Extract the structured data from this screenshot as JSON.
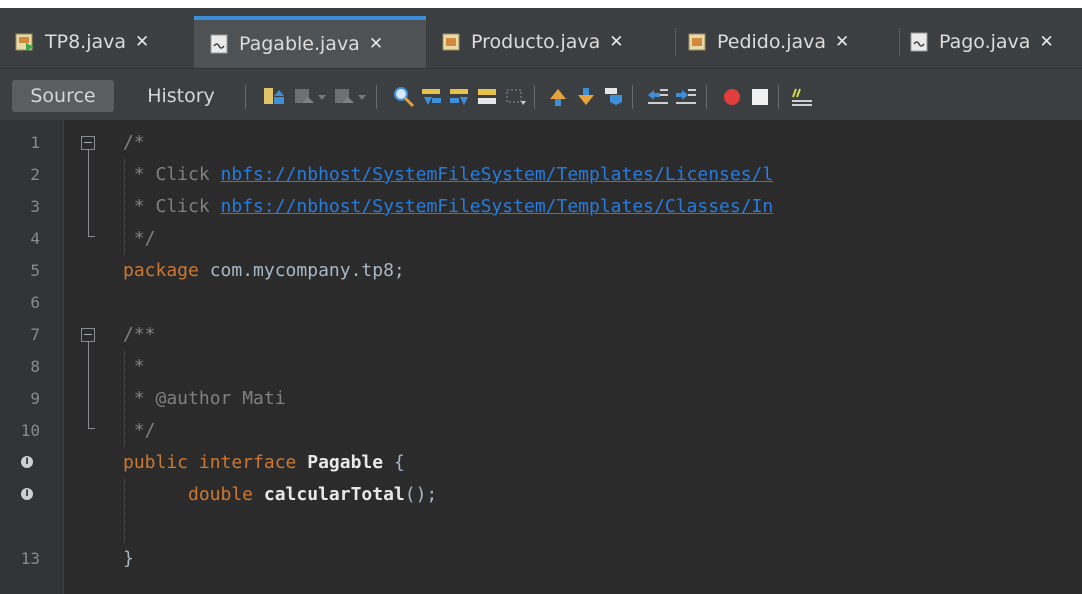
{
  "tabs": [
    {
      "label": "TP8.java",
      "close": "✕",
      "icon": "java-main-class-icon"
    },
    {
      "label": "Pagable.java",
      "close": "✕",
      "icon": "java-interface-icon",
      "active": true
    },
    {
      "label": "Producto.java",
      "close": "✕",
      "icon": "java-class-icon"
    },
    {
      "label": "Pedido.java",
      "close": "✕",
      "icon": "java-class-icon"
    },
    {
      "label": "Pago.java",
      "close": "✕",
      "icon": "java-interface-icon"
    }
  ],
  "toolbar": {
    "source_label": "Source",
    "history_label": "History"
  },
  "gutter": {
    "line_numbers": [
      "1",
      "2",
      "3",
      "4",
      "5",
      "6",
      "7",
      "8",
      "9",
      "10",
      "",
      "",
      "13"
    ],
    "interface_badge": "I"
  },
  "code": {
    "l1": "/*",
    "l2_prefix": " * Click ",
    "l2_link": "nbfs://nbhost/SystemFileSystem/Templates/Licenses/l",
    "l3_prefix": " * Click ",
    "l3_link": "nbfs://nbhost/SystemFileSystem/Templates/Classes/In",
    "l4": " */",
    "l5_kw": "package",
    "l5_rest": " com.mycompany.tp8;",
    "l7": "/**",
    "l8": " *",
    "l9": " * @author Mati",
    "l10": " */",
    "l11_kw": "public interface",
    "l11_name": " Pagable",
    "l11_rest": " {",
    "l12_kw": "double",
    "l12_name": " calcularTotal",
    "l12_rest": "();",
    "l13": "}"
  },
  "colors": {
    "keyword": "#cc7832",
    "comment": "#808080",
    "link": "#287bde",
    "text": "#a9b7c6",
    "active_tab_accent": "#3d8ed8",
    "breakpoint": "#e23d3d"
  }
}
